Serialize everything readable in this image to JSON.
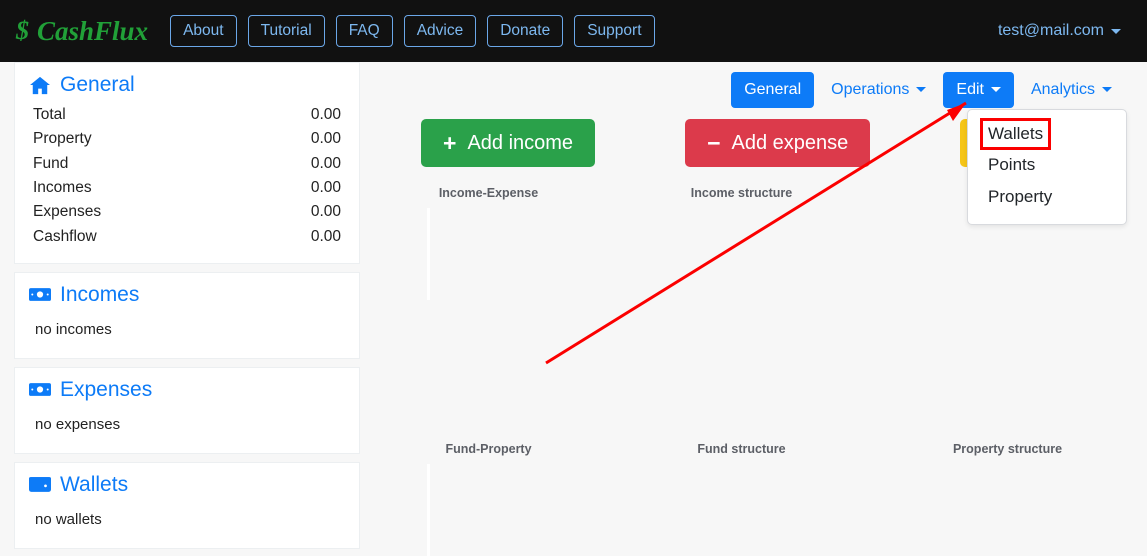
{
  "navbar": {
    "brand": "CashFlux",
    "brand_symbol": "$",
    "links": [
      {
        "label": "About"
      },
      {
        "label": "Tutorial"
      },
      {
        "label": "FAQ"
      },
      {
        "label": "Advice"
      },
      {
        "label": "Donate"
      },
      {
        "label": "Support"
      }
    ],
    "user": "test@mail.com"
  },
  "sidebar": {
    "general": {
      "title": "General",
      "icon": "home-icon",
      "rows": [
        {
          "label": "Total",
          "value": "0.00"
        },
        {
          "label": "Property",
          "value": "0.00"
        },
        {
          "label": "Fund",
          "value": "0.00"
        },
        {
          "label": "Incomes",
          "value": "0.00"
        },
        {
          "label": "Expenses",
          "value": "0.00"
        },
        {
          "label": "Cashflow",
          "value": "0.00"
        }
      ]
    },
    "incomes": {
      "title": "Incomes",
      "icon": "money-bill-icon",
      "empty": "no incomes"
    },
    "expenses": {
      "title": "Expenses",
      "icon": "money-bill-icon",
      "empty": "no expenses"
    },
    "wallets": {
      "title": "Wallets",
      "icon": "wallet-icon",
      "empty": "no wallets"
    }
  },
  "main": {
    "tabs": [
      {
        "label": "General",
        "active": true,
        "caret": false
      },
      {
        "label": "Operations",
        "active": false,
        "caret": true
      },
      {
        "label": "Edit",
        "active": true,
        "caret": true
      },
      {
        "label": "Analytics",
        "active": false,
        "caret": true
      }
    ],
    "actions": [
      {
        "label": "Add income",
        "sign": "+",
        "color": "#2aa14a"
      },
      {
        "label": "Add expense",
        "sign": "−",
        "color": "#dc3a4b"
      },
      {
        "label": "",
        "sign": "transfer-icon",
        "color": "#f5c518"
      }
    ],
    "dropdown": {
      "items": [
        {
          "label": "Wallets",
          "highlighted": true
        },
        {
          "label": "Points",
          "highlighted": false
        },
        {
          "label": "Property",
          "highlighted": false
        }
      ]
    },
    "charts_top": [
      {
        "title": "Income-Expense",
        "axis": true
      },
      {
        "title": "Income structure",
        "axis": false
      },
      {
        "title": "",
        "axis": false
      }
    ],
    "charts_bottom": [
      {
        "title": "Fund-Property",
        "axis": true
      },
      {
        "title": "Fund structure",
        "axis": false
      },
      {
        "title": "Property structure",
        "axis": false
      }
    ]
  },
  "colors": {
    "brand_green": "#21a038",
    "accent_blue": "#0d7bf7",
    "navbar_bg": "#111111",
    "page_bg": "#f7f7f7",
    "annotation_red": "#fb0000",
    "income_green": "#2aa14a",
    "expense_red": "#dc3a4b",
    "transfer_yellow": "#f5c518"
  }
}
